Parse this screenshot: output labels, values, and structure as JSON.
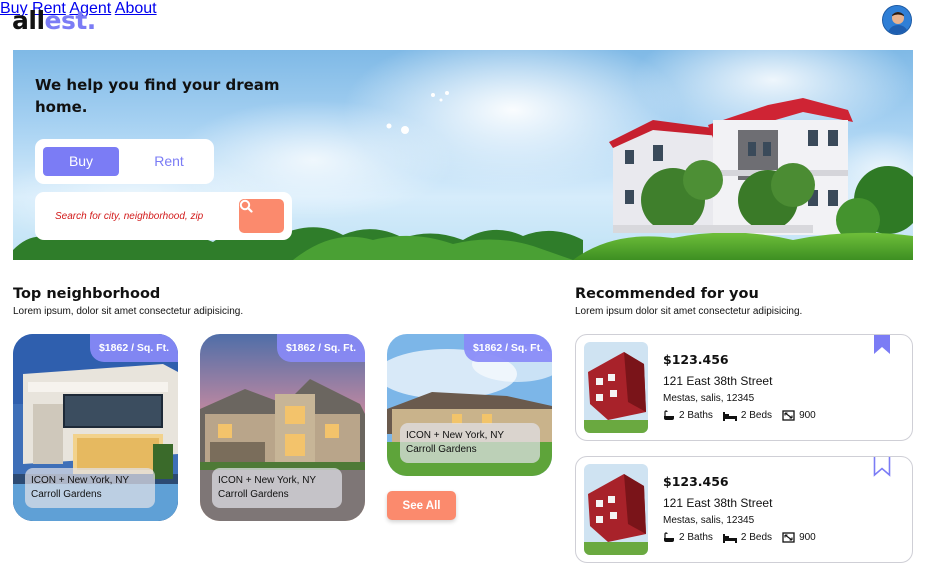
{
  "brand": {
    "logo_part1": "all",
    "logo_part2": "est."
  },
  "nav": {
    "items": [
      {
        "label": "Buy"
      },
      {
        "label": "Rent"
      },
      {
        "label": "Agent"
      },
      {
        "label": "About"
      }
    ]
  },
  "hero": {
    "title": "We help you find your dream home.",
    "tab_buy": "Buy",
    "tab_rent": "Rent",
    "search_placeholder": "Search for city, neighborhood, zip"
  },
  "top_neighborhood": {
    "title": "Top neighborhood",
    "subtitle": "Lorem ipsum, dolor sit amet consectetur adipisicing.",
    "cards": [
      {
        "price": "$1862 / Sq. Ft.",
        "location_line1": "ICON + New York, NY",
        "location_line2": "Carroll Gardens"
      },
      {
        "price": "$1862 / Sq. Ft.",
        "location_line1": "ICON + New York, NY",
        "location_line2": "Carroll Gardens"
      },
      {
        "price": "$1862 / Sq. Ft.",
        "location_line1": "ICON + New York, NY",
        "location_line2": "Carroll Gardens"
      }
    ],
    "see_all": "See All"
  },
  "recommended": {
    "title": "Recommended for you",
    "subtitle": "Lorem ipsum dolor sit amet consectetur adipisicing.",
    "listings": [
      {
        "price": "$123.456",
        "address": "121 East 38th Street",
        "city": "Mestas, salis, 12345",
        "baths": "2 Baths",
        "beds": "2 Beds",
        "area": "900",
        "saved": true
      },
      {
        "price": "$123.456",
        "address": "121 East 38th Street",
        "city": "Mestas, salis, 12345",
        "baths": "2 Baths",
        "beds": "2 Beds",
        "area": "900",
        "saved": false
      }
    ]
  },
  "colors": {
    "accent": "#7b7cf5",
    "cta": "#fb8a6d",
    "text": "#111111",
    "border": "#cfcfd6"
  },
  "icons": {
    "search": "search-icon",
    "bath": "bath-icon",
    "bed": "bed-icon",
    "area": "area-icon",
    "bookmark": "bookmark-icon"
  }
}
